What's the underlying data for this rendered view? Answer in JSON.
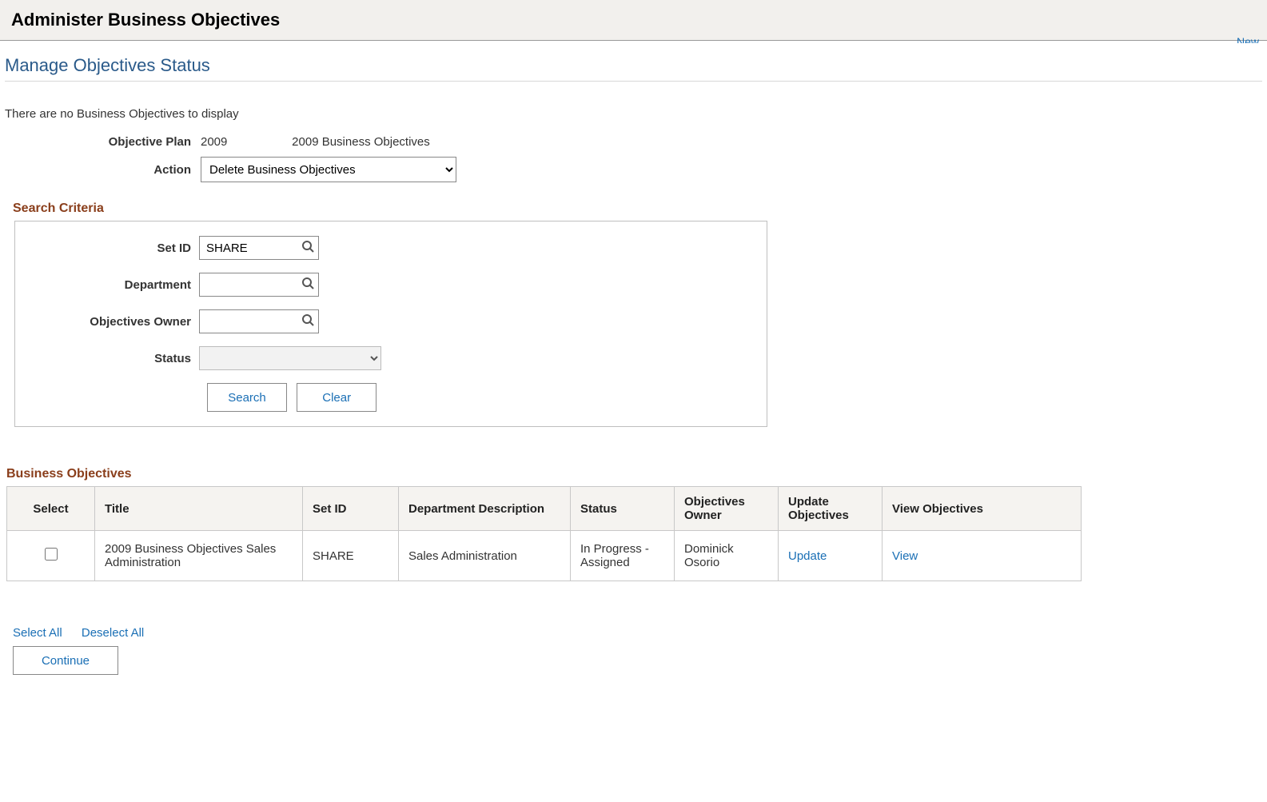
{
  "header": {
    "title": "Administer Business Objectives",
    "top_link": "New"
  },
  "subtitle": "Manage Objectives Status",
  "info_message": "There are no Business Objectives to display",
  "plan": {
    "label": "Objective Plan",
    "year": "2009",
    "name": "2009 Business Objectives"
  },
  "action": {
    "label": "Action",
    "selected": "Delete Business Objectives"
  },
  "search": {
    "heading": "Search Criteria",
    "setid_label": "Set ID",
    "setid_value": "SHARE",
    "department_label": "Department",
    "department_value": "",
    "owner_label": "Objectives Owner",
    "owner_value": "",
    "status_label": "Status",
    "status_value": "",
    "search_btn": "Search",
    "clear_btn": "Clear"
  },
  "results": {
    "heading": "Business Objectives",
    "columns": {
      "select": "Select",
      "title": "Title",
      "setid": "Set ID",
      "dept": "Department Description",
      "status": "Status",
      "owner": "Objectives Owner",
      "update": "Update Objectives",
      "view": "View Objectives"
    },
    "rows": [
      {
        "title": "2009 Business Objectives Sales Administration",
        "setid": "SHARE",
        "dept": "Sales Administration",
        "status": "In Progress - Assigned",
        "owner": "Dominick Osorio",
        "update_link": "Update",
        "view_link": "View"
      }
    ]
  },
  "footer": {
    "select_all": "Select All",
    "deselect_all": "Deselect All",
    "continue": "Continue"
  }
}
